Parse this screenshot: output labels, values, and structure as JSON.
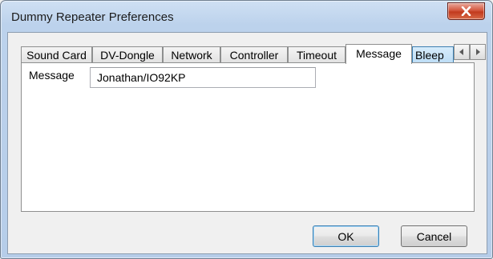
{
  "window": {
    "title": "Dummy Repeater Preferences"
  },
  "tabs": [
    {
      "label": "Sound Card"
    },
    {
      "label": "DV-Dongle"
    },
    {
      "label": "Network"
    },
    {
      "label": "Controller"
    },
    {
      "label": "Timeout"
    },
    {
      "label": "Message",
      "active": true
    },
    {
      "label": "Bleep"
    }
  ],
  "message_panel": {
    "label": "Message",
    "value": "Jonathan/IO92KP"
  },
  "buttons": {
    "ok": "OK",
    "cancel": "Cancel"
  },
  "icons": {
    "close": "close-icon",
    "tab_scroll_left": "arrow-left-icon",
    "tab_scroll_right": "arrow-right-icon"
  },
  "colors": {
    "titlebar": "#bcd2ec",
    "close_button": "#c8452b",
    "focus_border": "#3c7fb1"
  }
}
